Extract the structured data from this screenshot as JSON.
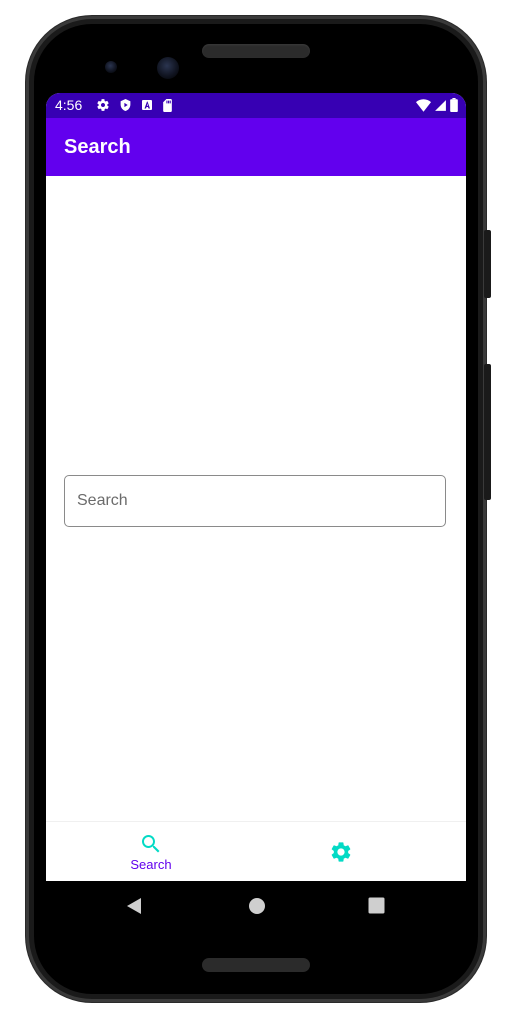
{
  "status_bar": {
    "time": "4:56",
    "left_icons": [
      "gear-icon",
      "play-protect-icon",
      "a-icon",
      "sd-card-icon"
    ],
    "right_icons": [
      "wifi-icon",
      "signal-icon",
      "battery-icon"
    ]
  },
  "app_bar": {
    "title": "Search"
  },
  "search": {
    "placeholder": "Search",
    "value": ""
  },
  "bottom_nav": {
    "items": [
      {
        "label": "Search",
        "icon": "search-icon",
        "selected": true
      },
      {
        "label": "",
        "icon": "gear-icon",
        "selected": false
      }
    ]
  },
  "system_nav": [
    "back-icon",
    "home-icon",
    "recents-icon"
  ],
  "colors": {
    "status_bar": "#3700b3",
    "app_bar": "#6200ee",
    "accent": "#03dac5",
    "selected_label": "#6200ee"
  }
}
